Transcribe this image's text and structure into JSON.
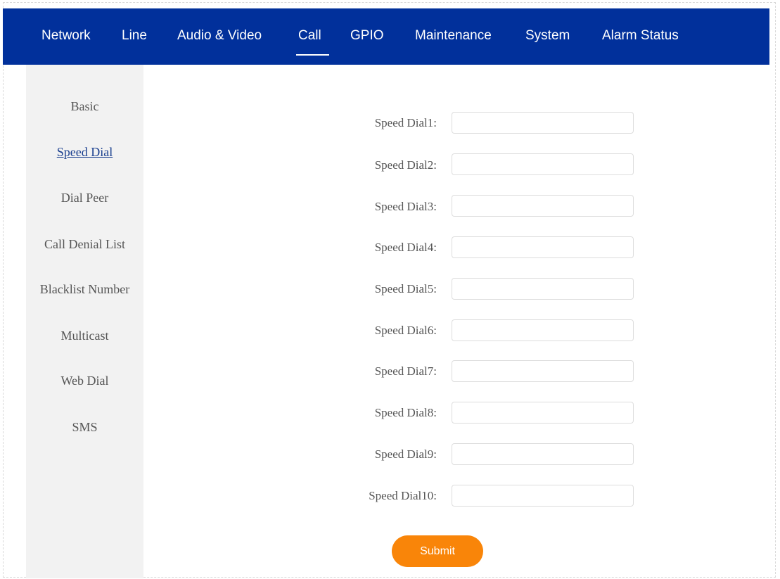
{
  "nav": {
    "items": [
      {
        "label": "Network"
      },
      {
        "label": "Line"
      },
      {
        "label": "Audio & Video"
      },
      {
        "label": "Call"
      },
      {
        "label": "GPIO"
      },
      {
        "label": "Maintenance"
      },
      {
        "label": "System"
      },
      {
        "label": "Alarm Status"
      }
    ],
    "active": "Call"
  },
  "sidebar": {
    "items": [
      {
        "label": "Basic"
      },
      {
        "label": "Speed Dial"
      },
      {
        "label": "Dial Peer"
      },
      {
        "label": "Call Denial List"
      },
      {
        "label": "Blacklist Number"
      },
      {
        "label": "Multicast"
      },
      {
        "label": "Web Dial"
      },
      {
        "label": "SMS"
      }
    ],
    "active": "Speed Dial"
  },
  "form": {
    "fields": [
      {
        "label": "Speed Dial1:",
        "value": ""
      },
      {
        "label": "Speed Dial2:",
        "value": ""
      },
      {
        "label": "Speed Dial3:",
        "value": ""
      },
      {
        "label": "Speed Dial4:",
        "value": ""
      },
      {
        "label": "Speed Dial5:",
        "value": ""
      },
      {
        "label": "Speed Dial6:",
        "value": ""
      },
      {
        "label": "Speed Dial7:",
        "value": ""
      },
      {
        "label": "Speed Dial8:",
        "value": ""
      },
      {
        "label": "Speed Dial9:",
        "value": ""
      },
      {
        "label": "Speed Dial10:",
        "value": ""
      }
    ],
    "submit_label": "Submit"
  },
  "colors": {
    "nav_background": "#01309b",
    "sidebar_background": "#f2f2f2",
    "submit_button": "#f98509",
    "active_link": "#1a3f8f"
  }
}
